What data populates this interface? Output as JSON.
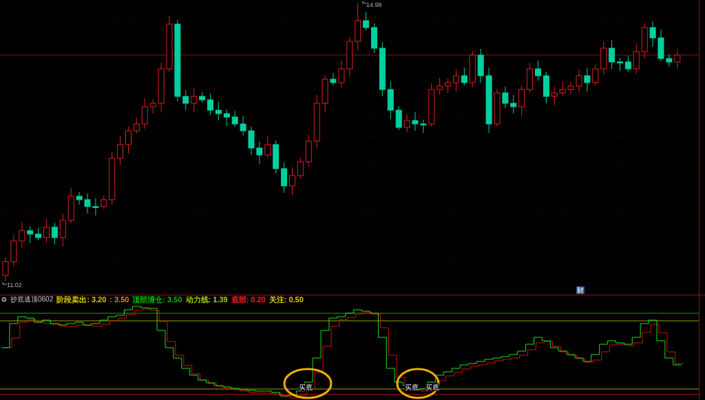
{
  "price_chart": {
    "high_label": "14.98",
    "low_label": "11.02",
    "event_badge": "财"
  },
  "indicator": {
    "name": "抄底逃顶0602",
    "legend": [
      {
        "label": "阶段卖出:",
        "value": "3.20",
        "color": "#d8d000"
      },
      {
        "label": ":",
        "value": "3.50",
        "color": "#e08a00"
      },
      {
        "label": "顶部清仓:",
        "value": "3.50",
        "color": "#00c000"
      },
      {
        "label": "动力线:",
        "value": "1.39",
        "color": "#a0d000"
      },
      {
        "label": "底部:",
        "value": "0.20",
        "color": "#ff2020"
      },
      {
        "label": "关注:",
        "value": "0.50",
        "color": "#e0d000"
      }
    ],
    "signals": [
      {
        "label": "买底"
      },
      {
        "label": "买底"
      },
      {
        "label": "买底"
      }
    ]
  }
}
